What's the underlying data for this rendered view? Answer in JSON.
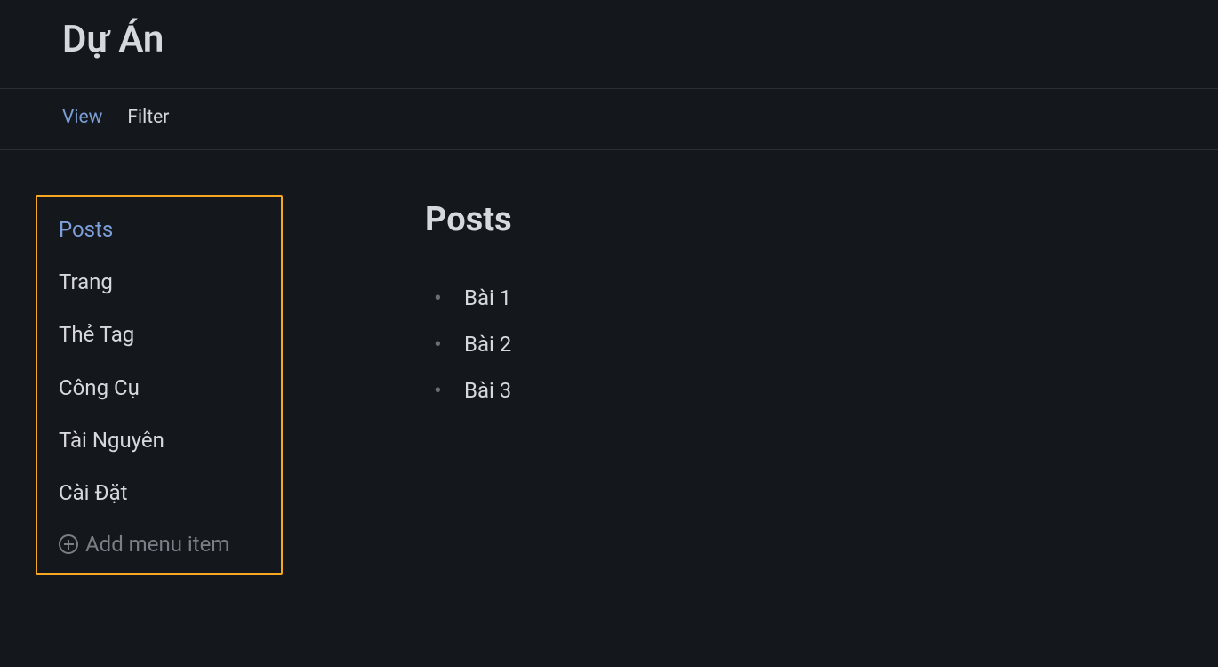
{
  "header": {
    "title": "Dự Án"
  },
  "toolbar": {
    "view_label": "View",
    "filter_label": "Filter"
  },
  "sidebar": {
    "items": [
      {
        "label": "Posts",
        "active": true
      },
      {
        "label": "Trang",
        "active": false
      },
      {
        "label": "Thẻ Tag",
        "active": false
      },
      {
        "label": "Công Cụ",
        "active": false
      },
      {
        "label": "Tài Nguyên",
        "active": false
      },
      {
        "label": "Cài Đặt",
        "active": false
      }
    ],
    "add_label": "Add menu item"
  },
  "main": {
    "title": "Posts",
    "posts": [
      "Bài 1",
      "Bài 2",
      "Bài 3"
    ]
  }
}
